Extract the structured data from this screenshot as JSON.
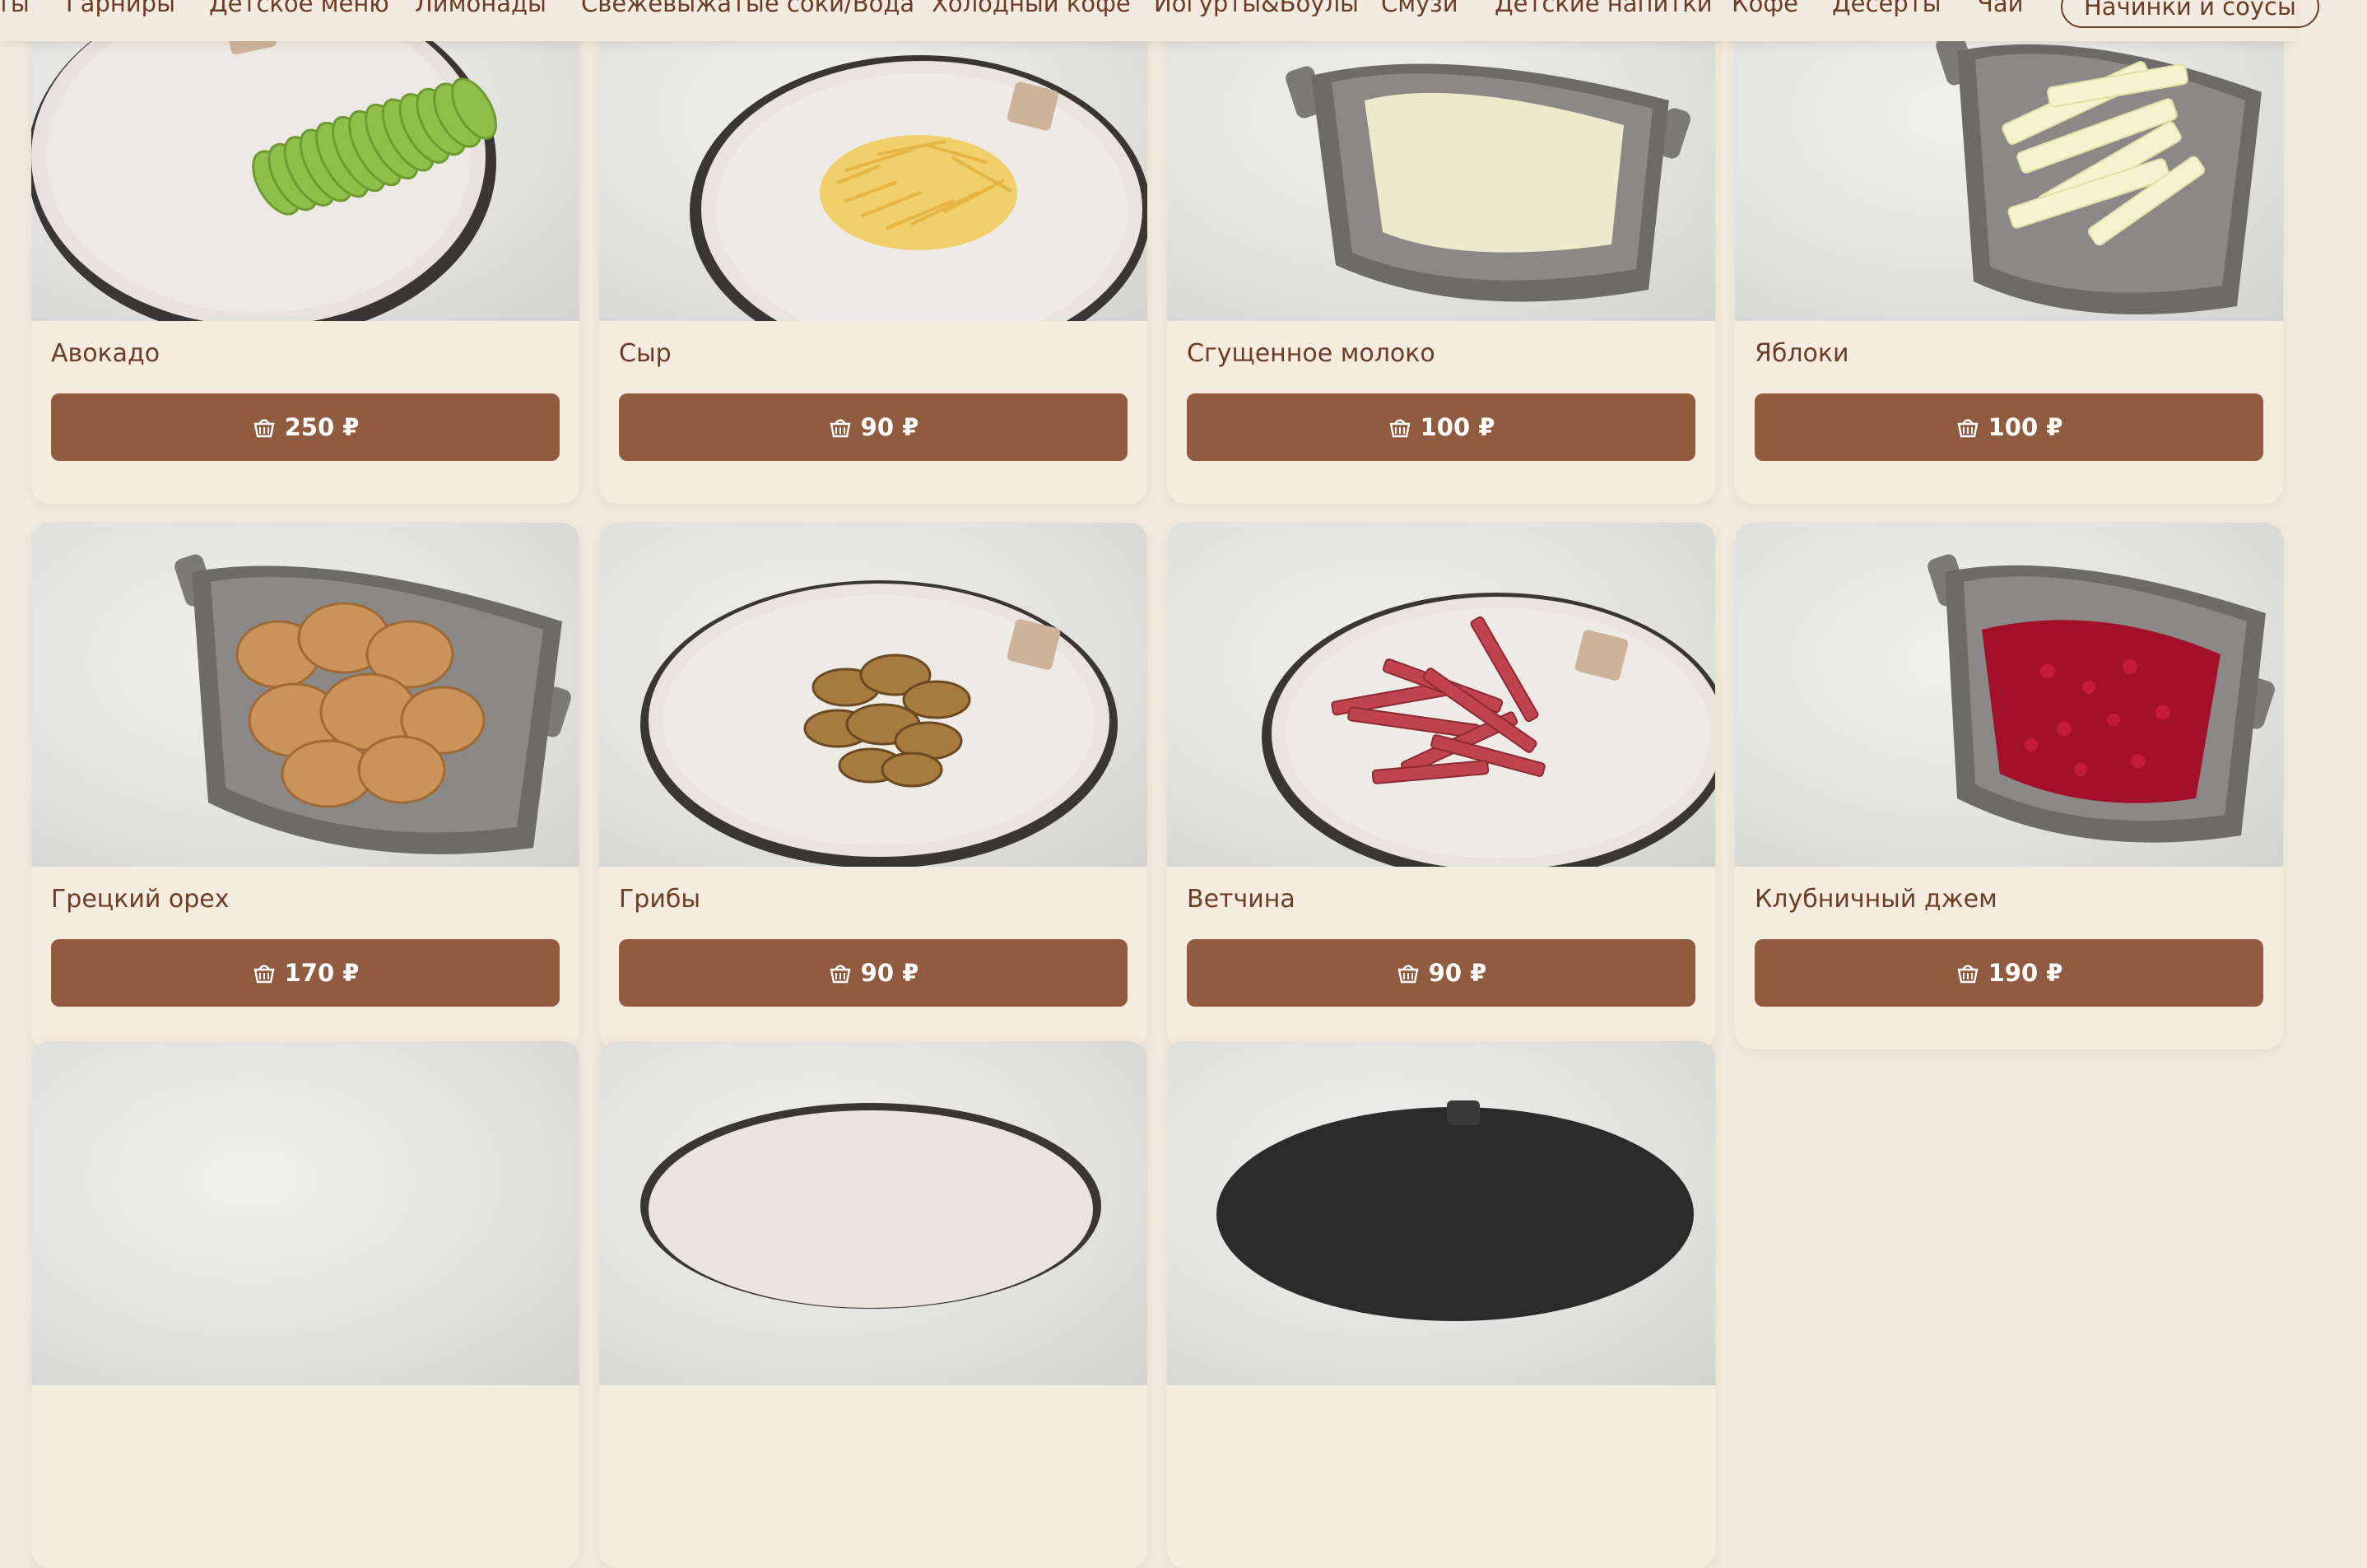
{
  "nav": {
    "items": [
      "ты",
      "Гарниры",
      "Детское меню",
      "Лимонады",
      "Свежевыжатые соки/Вода",
      "Холодный кофе",
      "Йогурты&Боулы",
      "Смузи",
      "Детские напитки",
      "Кофе",
      "Чай",
      "Десерты",
      "Начинки и соусы"
    ],
    "active": "Начинки и соусы"
  },
  "products": [
    {
      "name": "Авокадо",
      "price": "250 ₽"
    },
    {
      "name": "Сыр",
      "price": "90 ₽"
    },
    {
      "name": "Сгущенное молоко",
      "price": "100 ₽"
    },
    {
      "name": "Яблоки",
      "price": "100 ₽"
    },
    {
      "name": "Грецкий орех",
      "price": "170 ₽"
    },
    {
      "name": "Грибы",
      "price": "90 ₽"
    },
    {
      "name": "Ветчина",
      "price": "90 ₽"
    },
    {
      "name": "Клубничный джем",
      "price": "190 ₽"
    }
  ],
  "colors": {
    "background": "#f3ebe0",
    "card": "#f5ebdf",
    "button": "#915b40",
    "text": "#6b3d27"
  },
  "icons": {
    "price_button": "basket-icon"
  }
}
